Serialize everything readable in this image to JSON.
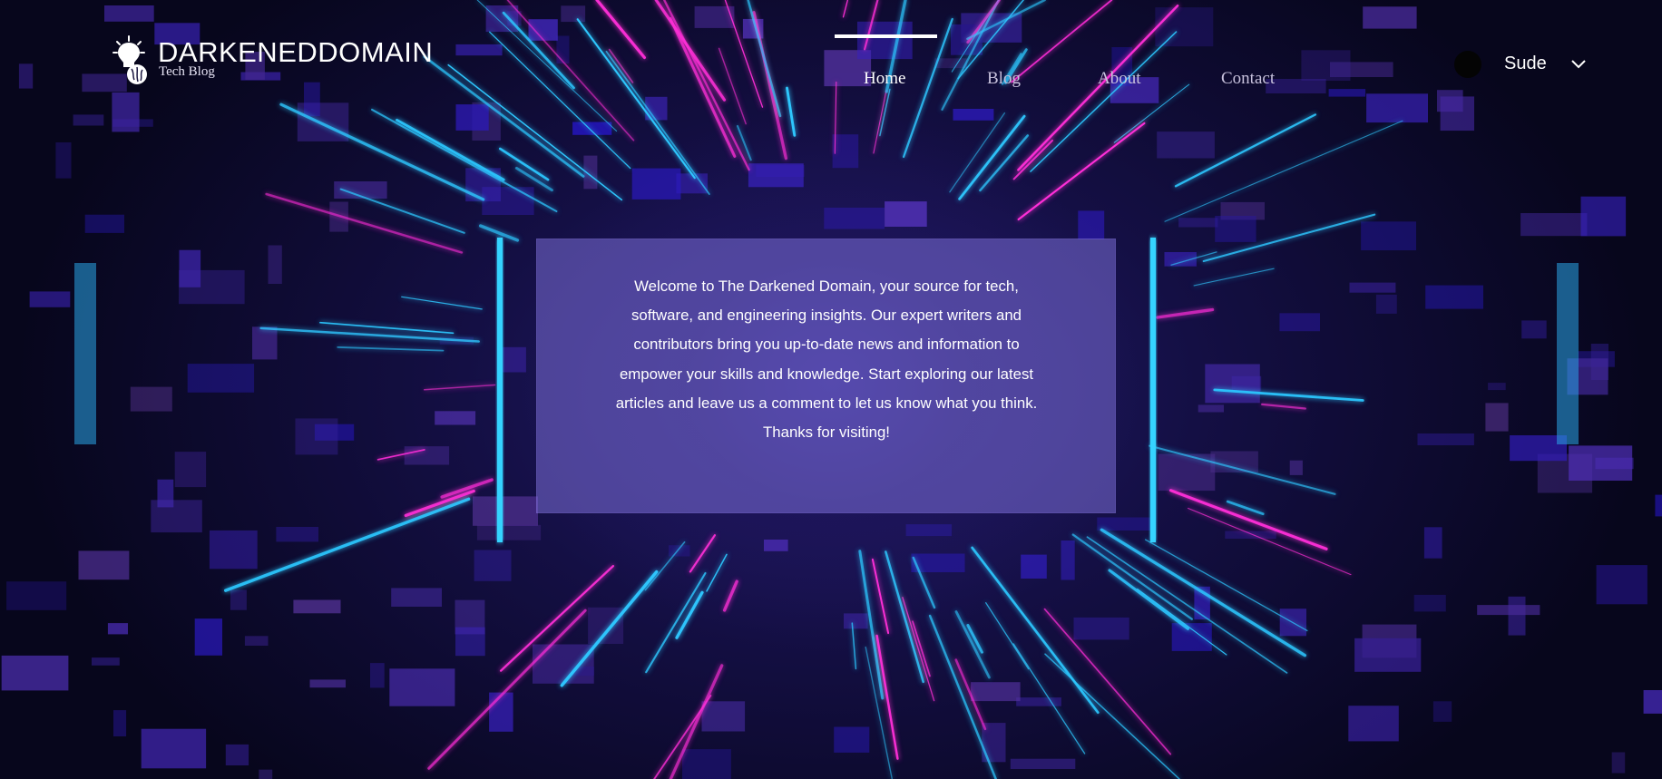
{
  "header": {
    "logo": {
      "icon": "lightbulb-brain-icon",
      "title": "DARKENEDDOMAIN",
      "subtitle": "Tech Blog"
    },
    "nav": {
      "active_index": 0,
      "items": [
        {
          "label": "Home"
        },
        {
          "label": "Blog"
        },
        {
          "label": "About"
        },
        {
          "label": "Contact"
        }
      ]
    },
    "user": {
      "name": "Sude",
      "avatar_icon": "avatar-circle",
      "menu_icon": "chevron-down-icon"
    }
  },
  "intro": {
    "text": "Welcome to The Darkened Domain, your source for tech, software, and engineering insights. Our expert writers and contributors bring you up-to-date news and information to empower your skills and knowledge. Start exploring our latest articles and leave us a comment to let us know what you think. Thanks for visiting!"
  },
  "colors": {
    "accent_blue": "#2ec8ff",
    "accent_magenta": "#ff2fd8",
    "card_purple": "#8476e4",
    "background": "#0b0a2a"
  }
}
